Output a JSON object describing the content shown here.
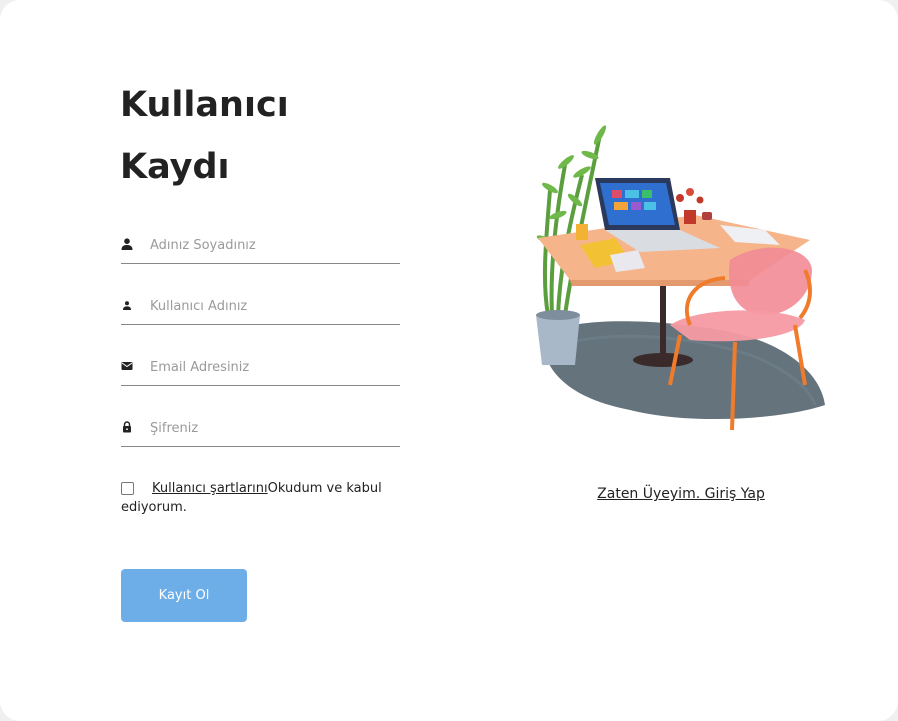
{
  "form": {
    "title_line1": "Kullanıcı",
    "title_line2": "Kaydı",
    "fields": [
      {
        "placeholder": "Adınız Soyadınız",
        "icon": "user-icon"
      },
      {
        "placeholder": "Kullanıcı Adınız",
        "icon": "user-small-icon"
      },
      {
        "placeholder": "Email Adresiniz",
        "icon": "envelope-icon"
      },
      {
        "placeholder": "Şifreniz",
        "icon": "lock-icon"
      }
    ],
    "terms": {
      "link_text": "Kullanıcı şartlarını",
      "rest_text": "Okudum ve kabul ediyorum.",
      "checked": false
    },
    "submit_label": "Kayıt Ol"
  },
  "aside": {
    "illustration": "desk-laptop-plant-chair-illustration",
    "login_link": "Zaten Üyeyim. Giriş Yap"
  },
  "colors": {
    "accent": "#6daee8",
    "text": "#222222",
    "placeholder": "#9a9a9a"
  }
}
